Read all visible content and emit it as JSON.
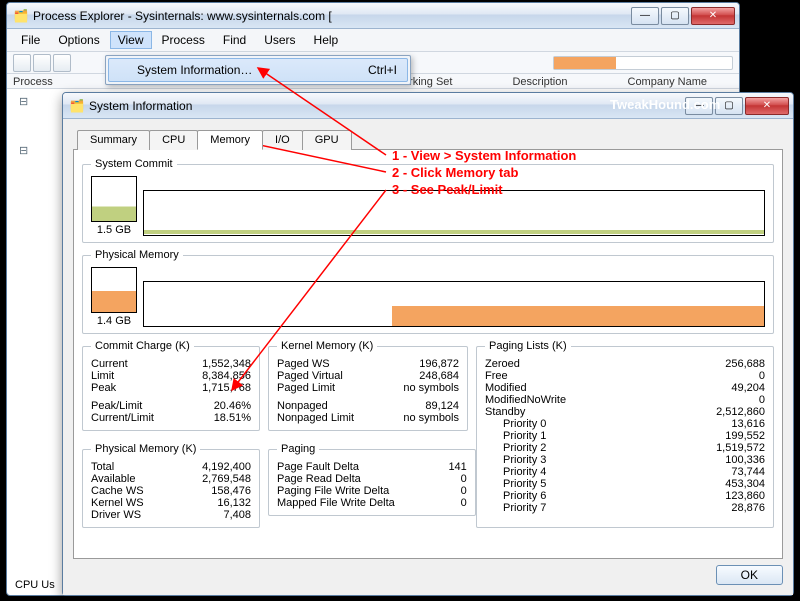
{
  "parent": {
    "title": "Process Explorer - Sysinternals: www.sysinternals.com [",
    "menu": [
      "File",
      "Options",
      "View",
      "Process",
      "Find",
      "Users",
      "Help"
    ],
    "cols": {
      "proc": "Process",
      "ws": "Working Set",
      "desc": "Description",
      "comp": "Company Name"
    },
    "popup": {
      "label": "System Information…",
      "shortcut": "Ctrl+I"
    },
    "sidebar": {
      "cpu": "CPU Us"
    }
  },
  "sysinfo": {
    "title": "System Information",
    "tabs": [
      "Summary",
      "CPU",
      "Memory",
      "I/O",
      "GPU"
    ],
    "sysCommit": {
      "legend": "System Commit",
      "thumb": "1.5 GB"
    },
    "physMem": {
      "legend": "Physical Memory",
      "thumb": "1.4 GB"
    },
    "commit": {
      "legend": "Commit Charge (K)",
      "current_k": "Current",
      "current_v": "1,552,348",
      "limit_k": "Limit",
      "limit_v": "8,384,856",
      "peak_k": "Peak",
      "peak_v": "1,715,768",
      "pl_k": "Peak/Limit",
      "pl_v": "20.46%",
      "cl_k": "Current/Limit",
      "cl_v": "18.51%"
    },
    "physk": {
      "legend": "Physical Memory (K)",
      "total_k": "Total",
      "total_v": "4,192,400",
      "avail_k": "Available",
      "avail_v": "2,769,548",
      "cache_k": "Cache WS",
      "cache_v": "158,476",
      "kern_k": "Kernel WS",
      "kern_v": "16,132",
      "drv_k": "Driver WS",
      "drv_v": "7,408"
    },
    "kernel": {
      "legend": "Kernel Memory (K)",
      "pws_k": "Paged WS",
      "pws_v": "196,872",
      "pv_k": "Paged Virtual",
      "pv_v": "248,684",
      "pl_k": "Paged Limit",
      "pl_v": "no symbols",
      "np_k": "Nonpaged",
      "np_v": "89,124",
      "npl_k": "Nonpaged Limit",
      "npl_v": "no symbols"
    },
    "paging": {
      "legend": "Paging",
      "pfd_k": "Page Fault Delta",
      "pfd_v": "141",
      "prd_k": "Page Read Delta",
      "prd_v": "0",
      "pfw_k": "Paging File Write Delta",
      "pfw_v": "0",
      "mfw_k": "Mapped File Write Delta",
      "mfw_v": "0"
    },
    "pagingLists": {
      "legend": "Paging Lists (K)",
      "zero_k": "Zeroed",
      "zero_v": "256,688",
      "free_k": "Free",
      "free_v": "0",
      "mod_k": "Modified",
      "mod_v": "49,204",
      "mnw_k": "ModifiedNoWrite",
      "mnw_v": "0",
      "stb_k": "Standby",
      "stb_v": "2,512,860",
      "p0_k": "Priority 0",
      "p0_v": "13,616",
      "p1_k": "Priority 1",
      "p1_v": "199,552",
      "p2_k": "Priority 2",
      "p2_v": "1,519,572",
      "p3_k": "Priority 3",
      "p3_v": "100,336",
      "p4_k": "Priority 4",
      "p4_v": "73,744",
      "p5_k": "Priority 5",
      "p5_v": "453,304",
      "p6_k": "Priority 6",
      "p6_v": "123,860",
      "p7_k": "Priority 7",
      "p7_v": "28,876"
    },
    "ok": "OK"
  },
  "anno": {
    "l1": "1 - View > System Information",
    "l2": "2 - Click Memory tab",
    "l3": "3 - See Peak/Limit",
    "watermark": "TweakHound.com"
  }
}
